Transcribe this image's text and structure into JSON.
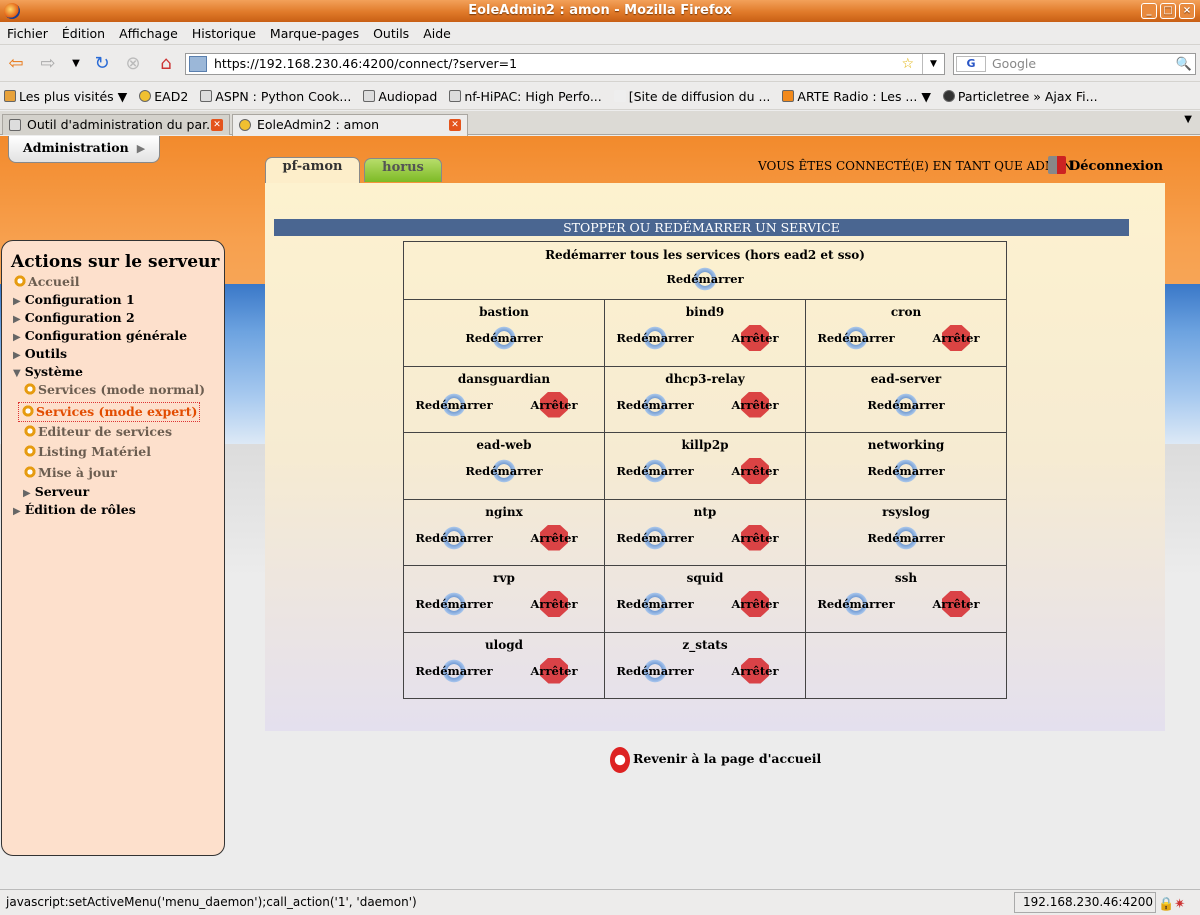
{
  "window": {
    "title": "EoleAdmin2 : amon - Mozilla Firefox",
    "controls": [
      "_",
      "□",
      "×"
    ]
  },
  "menubar": [
    "Fichier",
    "Édition",
    "Affichage",
    "Historique",
    "Marque-pages",
    "Outils",
    "Aide"
  ],
  "navbar": {
    "url": "https://192.168.230.46:4200/connect/?server=1",
    "search_placeholder": "Google",
    "search_engine": "G"
  },
  "bookmarks": [
    "Les plus visités ▼",
    "EAD2",
    "ASPN : Python Cook...",
    "Audiopad",
    "nf-HiPAC: High Perfo...",
    "[Site de diffusion du ...",
    "ARTE Radio : Les ... ▼",
    "Particletree » Ajax Fi..."
  ],
  "browser_tabs": [
    {
      "label": "Outil d'administration du par...",
      "active": false
    },
    {
      "label": "EoleAdmin2 : amon",
      "active": true
    }
  ],
  "app": {
    "admin_button": "Administration",
    "server_tabs": [
      "pf-amon",
      "horus"
    ],
    "user_info": "VOUS ÊTES CONNECTÉ(E) EN TANT QUE ADMIN",
    "logout": "Déconnexion",
    "section_title": "STOPPER OU REDÉMARRER UN SERVICE",
    "restart_all_title": "Redémarrer tous les services (hors ead2 et sso)",
    "restart_label": "Redémarrer",
    "stop_label": "Arrêter",
    "back_link": "Revenir à la page d'accueil",
    "services": [
      {
        "name": "bastion",
        "stop": false
      },
      {
        "name": "bind9",
        "stop": true
      },
      {
        "name": "cron",
        "stop": true
      },
      {
        "name": "dansguardian",
        "stop": true
      },
      {
        "name": "dhcp3-relay",
        "stop": true
      },
      {
        "name": "ead-server",
        "stop": false
      },
      {
        "name": "ead-web",
        "stop": false
      },
      {
        "name": "killp2p",
        "stop": true
      },
      {
        "name": "networking",
        "stop": false
      },
      {
        "name": "nginx",
        "stop": true
      },
      {
        "name": "ntp",
        "stop": true
      },
      {
        "name": "rsyslog",
        "stop": false
      },
      {
        "name": "rvp",
        "stop": true
      },
      {
        "name": "squid",
        "stop": true
      },
      {
        "name": "ssh",
        "stop": true
      },
      {
        "name": "ulogd",
        "stop": true
      },
      {
        "name": "z_stats",
        "stop": true
      }
    ]
  },
  "sidebar": {
    "title": "Actions sur le serveur",
    "items": [
      {
        "label": "Accueil",
        "type": "gear",
        "style": "grey"
      },
      {
        "label": "Configuration 1",
        "type": "arrow",
        "style": ""
      },
      {
        "label": "Configuration 2",
        "type": "arrow",
        "style": ""
      },
      {
        "label": "Configuration générale",
        "type": "arrow",
        "style": ""
      },
      {
        "label": "Outils",
        "type": "arrow",
        "style": ""
      },
      {
        "label": "Système",
        "type": "arrow-open",
        "style": ""
      },
      {
        "label": "Services (mode normal)",
        "type": "gear",
        "style": "grey"
      },
      {
        "label": "Services (mode expert)",
        "type": "gear",
        "style": "selected"
      },
      {
        "label": "Editeur de services",
        "type": "gear",
        "style": "grey"
      },
      {
        "label": "Listing Matériel",
        "type": "gear",
        "style": "grey"
      },
      {
        "label": "Mise à jour",
        "type": "gear",
        "style": "grey"
      },
      {
        "label": "Serveur",
        "type": "arrow",
        "style": ""
      },
      {
        "label": "Édition de rôles",
        "type": "arrow",
        "style": ""
      }
    ]
  },
  "statusbar": {
    "text": "javascript:setActiveMenu('menu_daemon');call_action('1', 'daemon')",
    "host": "192.168.230.46:4200"
  }
}
